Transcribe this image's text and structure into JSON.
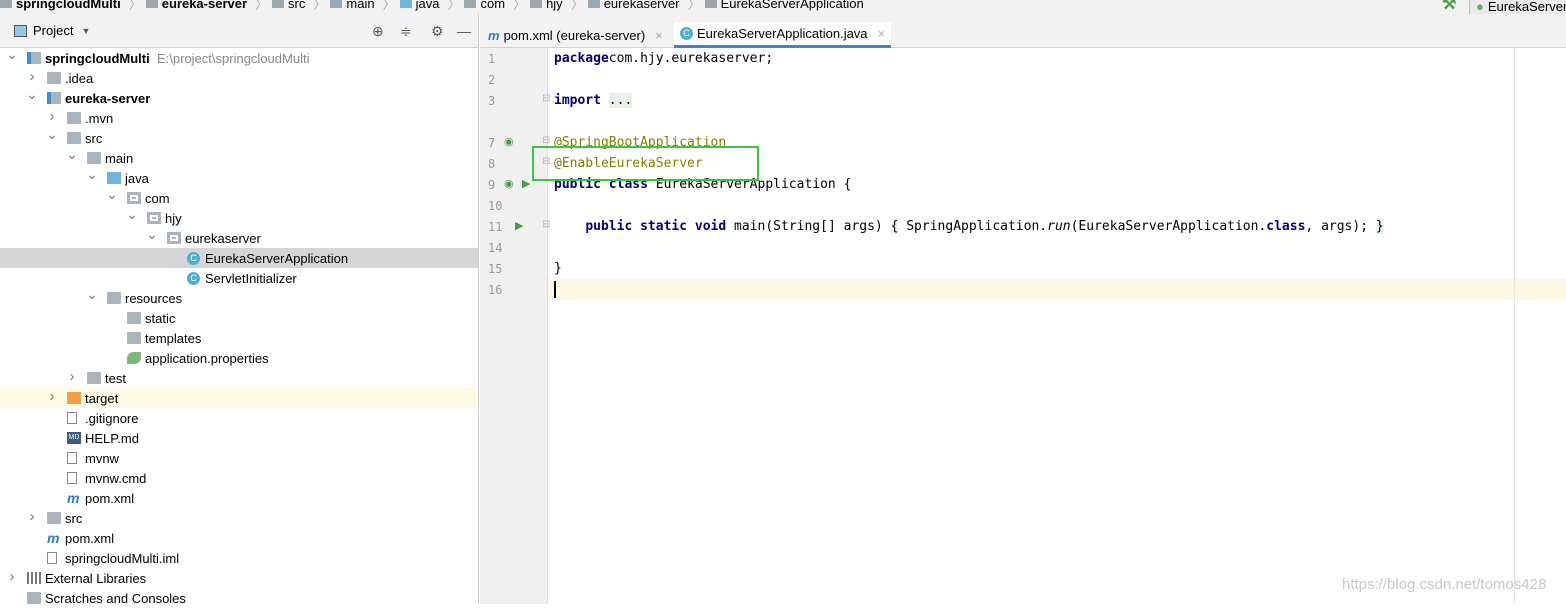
{
  "breadcrumbs": [
    "springcloudMulti",
    "eureka-server",
    "src",
    "main",
    "java",
    "com",
    "hjy",
    "eurekaserver",
    "EurekaServerApplication"
  ],
  "run_config": "EurekaServer",
  "project_panel": {
    "title": "Project",
    "dropdown_icon": "caret-down",
    "tools": [
      "locate-icon",
      "collapse-all-icon",
      "gear-icon",
      "minimize-icon"
    ]
  },
  "tree": [
    {
      "label": "springcloudMulti",
      "path": "E:\\project\\springcloudMulti",
      "level": 0,
      "arrow": "expanded",
      "icon": "module",
      "bold": true
    },
    {
      "label": ".idea",
      "level": 1,
      "arrow": "collapsed",
      "icon": "folder"
    },
    {
      "label": "eureka-server",
      "level": 1,
      "arrow": "expanded",
      "icon": "module",
      "bold": true
    },
    {
      "label": ".mvn",
      "level": 2,
      "arrow": "collapsed",
      "icon": "folder"
    },
    {
      "label": "src",
      "level": 2,
      "arrow": "expanded",
      "icon": "folder"
    },
    {
      "label": "main",
      "level": 3,
      "arrow": "expanded",
      "icon": "folder"
    },
    {
      "label": "java",
      "level": 4,
      "arrow": "expanded",
      "icon": "source-folder"
    },
    {
      "label": "com",
      "level": 5,
      "arrow": "expanded",
      "icon": "package"
    },
    {
      "label": "hjy",
      "level": 6,
      "arrow": "expanded",
      "icon": "package"
    },
    {
      "label": "eurekaserver",
      "level": 7,
      "arrow": "expanded",
      "icon": "package"
    },
    {
      "label": "EurekaServerApplication",
      "level": 8,
      "icon": "class",
      "selected": true
    },
    {
      "label": "ServletInitializer",
      "level": 8,
      "icon": "class"
    },
    {
      "label": "resources",
      "level": 4,
      "arrow": "expanded",
      "icon": "resources-folder"
    },
    {
      "label": "static",
      "level": 5,
      "icon": "folder"
    },
    {
      "label": "templates",
      "level": 5,
      "icon": "folder"
    },
    {
      "label": "application.properties",
      "level": 5,
      "icon": "spring-properties"
    },
    {
      "label": "test",
      "level": 3,
      "arrow": "collapsed",
      "icon": "folder"
    },
    {
      "label": "target",
      "level": 2,
      "arrow": "collapsed",
      "icon": "excluded-folder",
      "highlighted": true
    },
    {
      "label": ".gitignore",
      "level": 2,
      "icon": "file"
    },
    {
      "label": "HELP.md",
      "level": 2,
      "icon": "markdown"
    },
    {
      "label": "mvnw",
      "level": 2,
      "icon": "file"
    },
    {
      "label": "mvnw.cmd",
      "level": 2,
      "icon": "file"
    },
    {
      "label": "pom.xml",
      "level": 2,
      "icon": "maven"
    },
    {
      "label": "src",
      "level": 1,
      "arrow": "collapsed",
      "icon": "folder"
    },
    {
      "label": "pom.xml",
      "level": 1,
      "icon": "maven"
    },
    {
      "label": "springcloudMulti.iml",
      "level": 1,
      "icon": "file"
    },
    {
      "label": "External Libraries",
      "level": 0,
      "arrow": "collapsed",
      "icon": "library"
    },
    {
      "label": "Scratches and Consoles",
      "level": 0,
      "icon": "scratches"
    }
  ],
  "tabs": [
    {
      "label": "pom.xml (eureka-server)",
      "icon": "maven",
      "active": false
    },
    {
      "label": "EurekaServerApplication.java",
      "icon": "class",
      "active": true
    }
  ],
  "code": [
    {
      "n": "1",
      "tokens": [
        [
          "kw",
          "package"
        ],
        [
          "",
          "com.hjy.eurekaserver;"
        ]
      ]
    },
    {
      "n": "2",
      "tokens": []
    },
    {
      "n": "3",
      "tokens": [
        [
          "kw",
          "import"
        ],
        [
          "",
          " "
        ],
        [
          "fold",
          "..."
        ]
      ],
      "fold": true
    },
    {
      "n": "",
      "tokens": []
    },
    {
      "n": "7",
      "tokens": [
        [
          "an",
          "@SpringBootApplication"
        ]
      ],
      "fold": true,
      "gutter": "spring-bean-icon"
    },
    {
      "n": "8",
      "tokens": [
        [
          "an",
          "@EnableEurekaServer"
        ]
      ],
      "fold": true
    },
    {
      "n": "9",
      "tokens": [
        [
          "kw",
          "public class "
        ],
        [
          "",
          "EurekaServerApplication {"
        ]
      ],
      "gutter": "spring-run-icon"
    },
    {
      "n": "10",
      "tokens": []
    },
    {
      "n": "11",
      "tokens": [
        [
          "",
          "    "
        ],
        [
          "kw",
          "public static void "
        ],
        [
          "",
          "main(String[] args) "
        ],
        [
          "fold",
          "{"
        ],
        [
          "",
          " SpringApplication."
        ],
        [
          "it",
          "run"
        ],
        [
          "",
          "(EurekaServerApplication."
        ],
        [
          "kw",
          "class"
        ],
        [
          "",
          ", args); "
        ],
        [
          "fold",
          "}"
        ]
      ],
      "fold": true,
      "gutter": "run-icon"
    },
    {
      "n": "14",
      "tokens": []
    },
    {
      "n": "15",
      "tokens": [
        [
          "",
          "}"
        ]
      ]
    },
    {
      "n": "16",
      "tokens": []
    }
  ],
  "watermark": "https://blog.csdn.net/tomos428",
  "colors": {
    "keyword": "#000080",
    "annotation": "#808000",
    "highlight_box": "#3ec43e",
    "selection": "#d5d5d5",
    "current_line": "#fdf8e1"
  }
}
